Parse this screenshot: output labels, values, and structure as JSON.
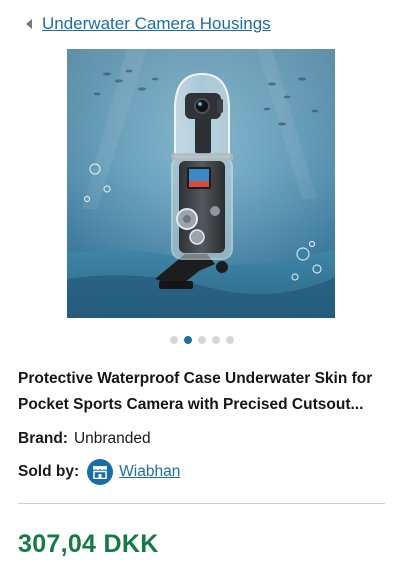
{
  "breadcrumb": {
    "back_icon": "chevron-left-icon",
    "label": "Underwater Camera Housings"
  },
  "product": {
    "image_alt_icon": "product-photo",
    "carousel": {
      "total": 5,
      "active_index": 1
    },
    "title": "Protective Waterproof Case Underwater Skin for Pocket Sports Camera with Precised Cutsout...",
    "brand_label": "Brand:",
    "brand_value": "Unbranded",
    "sold_by_label": "Sold by:",
    "seller_icon": "store-icon",
    "seller_name": "Wiabhan",
    "price": "307,04 DKK"
  },
  "colors": {
    "link": "#1a6ea8",
    "price": "#147a46",
    "dot_inactive": "#d6d6d6"
  }
}
